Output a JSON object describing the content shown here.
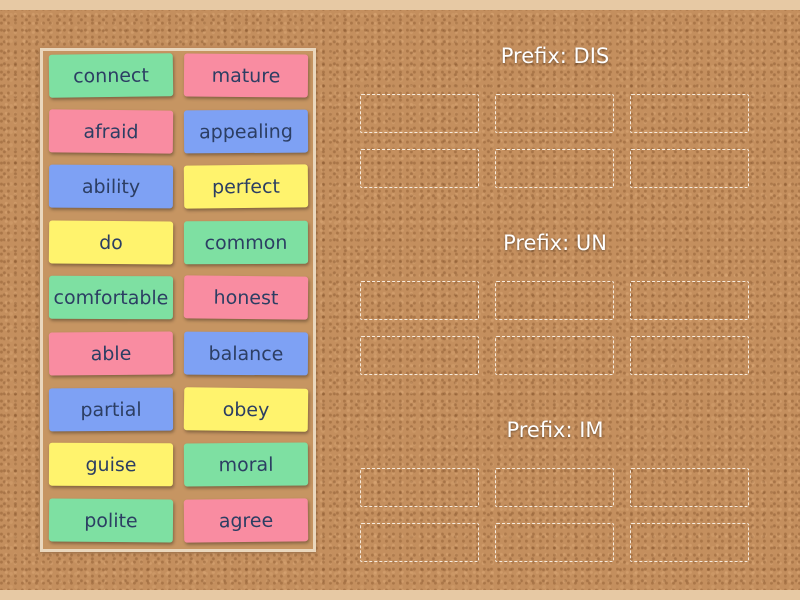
{
  "colors": {
    "green": "#7ee0a2",
    "pink": "#f98ca1",
    "blue": "#7ea1f4",
    "yellow": "#fff36d",
    "text": "#2c3e63"
  },
  "cards": [
    {
      "label": "connect",
      "color": "green"
    },
    {
      "label": "mature",
      "color": "pink"
    },
    {
      "label": "afraid",
      "color": "pink"
    },
    {
      "label": "appealing",
      "color": "blue"
    },
    {
      "label": "ability",
      "color": "blue"
    },
    {
      "label": "perfect",
      "color": "yellow"
    },
    {
      "label": "do",
      "color": "yellow"
    },
    {
      "label": "common",
      "color": "green"
    },
    {
      "label": "comfortable",
      "color": "green"
    },
    {
      "label": "honest",
      "color": "pink"
    },
    {
      "label": "able",
      "color": "pink"
    },
    {
      "label": "balance",
      "color": "blue"
    },
    {
      "label": "partial",
      "color": "blue"
    },
    {
      "label": "obey",
      "color": "yellow"
    },
    {
      "label": "guise",
      "color": "yellow"
    },
    {
      "label": "moral",
      "color": "green"
    },
    {
      "label": "polite",
      "color": "green"
    },
    {
      "label": "agree",
      "color": "pink"
    }
  ],
  "zones": [
    {
      "title": "Prefix: DIS"
    },
    {
      "title": "Prefix: UN"
    },
    {
      "title": "Prefix: IM"
    }
  ]
}
